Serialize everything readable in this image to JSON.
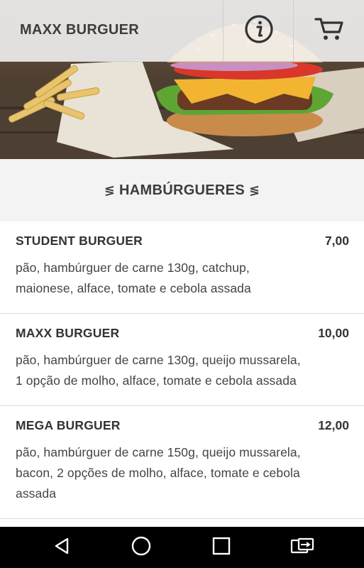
{
  "app": {
    "title": "MAXX BURGUER"
  },
  "toolbar": {
    "info_icon": "info-circle-icon",
    "cart_icon": "shopping-cart-icon"
  },
  "category": {
    "title": "HAMBÚRGUERES",
    "left_icon": "≶",
    "right_icon": "≶"
  },
  "menu": {
    "items": [
      {
        "name": "STUDENT BURGUER",
        "price": "7,00",
        "description": "pão, hambúrguer de carne 130g, catchup, maionese, alface, tomate e cebola assada"
      },
      {
        "name": "MAXX BURGUER",
        "price": "10,00",
        "description": "pão, hambúrguer de carne 130g, queijo mussarela, 1 opção de molho, alface, tomate e cebola assada"
      },
      {
        "name": "MEGA BURGUER",
        "price": "12,00",
        "description": "pão, hambúrguer de carne 150g, queijo mussarela, bacon, 2 opções de molho, alface, tomate e cebola assada"
      }
    ]
  },
  "navbar": {
    "back_icon": "back-triangle-icon",
    "home_icon": "home-circle-icon",
    "recent_icon": "recent-apps-square-icon",
    "switch_icon": "screen-switch-icon"
  },
  "colors": {
    "appbar_bg": "#f5f5f5",
    "category_bg": "#f3f3f3",
    "text": "#333333",
    "navbar_bg": "#000000"
  }
}
